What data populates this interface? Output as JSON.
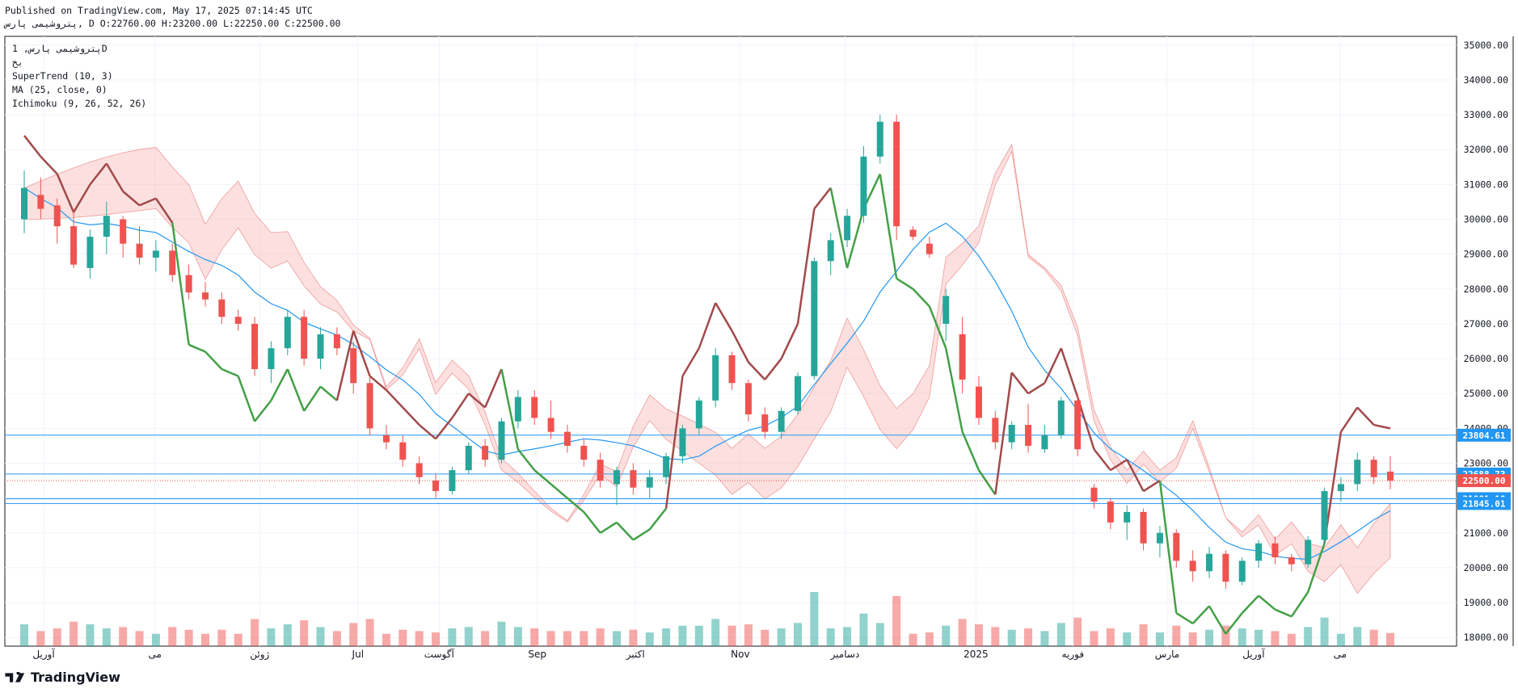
{
  "header": {
    "published": "Published on TradingView.com, May 17, 2025 07:14:45 UTC",
    "ohlc": "پتروشیمی پارس, D O:22760.00 H:23200.00 L:22250.00 C:22500.00"
  },
  "legend": {
    "symbol": "پتروشیمی پارس, 1D",
    "exchange": "بخ",
    "supertrend": "SuperTrend (10, 3)",
    "ma": "MA (25, close, 0)",
    "ichimoku": "Ichimoku (9, 26, 52, 26)"
  },
  "brand": "TradingView",
  "colors": {
    "up": "#26a69a",
    "down": "#ef5350",
    "st_up": "#43a047",
    "st_down": "#a24a4a",
    "ma": "#2196f3",
    "cloud_bull": "#a5d6a7",
    "cloud_bear": "#f8bbb8",
    "hline": "#2196f3",
    "last": "#ef5350"
  },
  "chart_data": {
    "type": "candlestick",
    "title": "پتروشیمی پارس, 1D",
    "x_labels": [
      "آوریل",
      "می",
      "ژوئن",
      "Jul",
      "آگوست",
      "Sep",
      "اکتبر",
      "Nov",
      "دسامبر",
      "2025",
      "فوریه",
      "مارس",
      "آوریل",
      "می"
    ],
    "y_ticks": [
      18000,
      19000,
      20000,
      21000,
      22000,
      23000,
      24000,
      25000,
      26000,
      27000,
      28000,
      29000,
      30000,
      31000,
      32000,
      33000,
      34000,
      35000
    ],
    "ylim": [
      17750,
      35250
    ],
    "horizontal_levels": [
      23804.61,
      22688.73,
      21981.1,
      21845.01
    ],
    "last_price": 22500.0,
    "candles_approx": [
      [
        30000,
        31400,
        29600,
        30900
      ],
      [
        30700,
        31200,
        30000,
        30300
      ],
      [
        30400,
        30600,
        29300,
        29800
      ],
      [
        29800,
        30300,
        28600,
        28700
      ],
      [
        28600,
        29700,
        28300,
        29500
      ],
      [
        29500,
        30500,
        29000,
        30100
      ],
      [
        30000,
        30100,
        28900,
        29300
      ],
      [
        29300,
        29800,
        28700,
        28900
      ],
      [
        28900,
        29400,
        28500,
        29100
      ],
      [
        29100,
        29300,
        28200,
        28400
      ],
      [
        28400,
        28700,
        27700,
        27900
      ],
      [
        27900,
        28200,
        27500,
        27700
      ],
      [
        27700,
        27900,
        27000,
        27200
      ],
      [
        27200,
        27400,
        26800,
        27000
      ],
      [
        27000,
        27200,
        25500,
        25700
      ],
      [
        25700,
        26500,
        25300,
        26300
      ],
      [
        26300,
        27400,
        26100,
        27200
      ],
      [
        27200,
        27400,
        25800,
        26000
      ],
      [
        26000,
        26900,
        25700,
        26700
      ],
      [
        26700,
        26900,
        26100,
        26300
      ],
      [
        26300,
        26500,
        25000,
        25300
      ],
      [
        25300,
        25500,
        23800,
        24000
      ],
      [
        23800,
        24100,
        23400,
        23600
      ],
      [
        23600,
        23800,
        22900,
        23100
      ],
      [
        23000,
        23200,
        22400,
        22600
      ],
      [
        22500,
        22700,
        22000,
        22200
      ],
      [
        22200,
        22900,
        22100,
        22800
      ],
      [
        22800,
        23600,
        22700,
        23500
      ],
      [
        23500,
        23700,
        22900,
        23100
      ],
      [
        23100,
        24300,
        23000,
        24200
      ],
      [
        24200,
        25100,
        24000,
        24900
      ],
      [
        24900,
        25100,
        24100,
        24300
      ],
      [
        24300,
        24800,
        23700,
        23900
      ],
      [
        23900,
        24100,
        23300,
        23500
      ],
      [
        23500,
        23700,
        22900,
        23100
      ],
      [
        23100,
        23300,
        22300,
        22500
      ],
      [
        22400,
        22900,
        21800,
        22800
      ],
      [
        22800,
        23000,
        22100,
        22300
      ],
      [
        22300,
        22800,
        22000,
        22600
      ],
      [
        22600,
        23300,
        22400,
        23200
      ],
      [
        23200,
        24100,
        23000,
        24000
      ],
      [
        24000,
        24900,
        23800,
        24800
      ],
      [
        24800,
        26300,
        24600,
        26100
      ],
      [
        26100,
        26200,
        25100,
        25300
      ],
      [
        25300,
        25400,
        24200,
        24400
      ],
      [
        24400,
        24600,
        23700,
        23900
      ],
      [
        23900,
        24600,
        23700,
        24500
      ],
      [
        24500,
        25600,
        24400,
        25500
      ],
      [
        25500,
        28900,
        25400,
        28800
      ],
      [
        28800,
        29600,
        28400,
        29400
      ],
      [
        29400,
        30300,
        29200,
        30100
      ],
      [
        30100,
        32100,
        29900,
        31800
      ],
      [
        31800,
        33000,
        31600,
        32800
      ],
      [
        32800,
        33000,
        29400,
        29800
      ],
      [
        29700,
        29800,
        29400,
        29500
      ],
      [
        29300,
        29500,
        28900,
        29000
      ],
      [
        27000,
        28000,
        26500,
        27800
      ],
      [
        26700,
        27200,
        25000,
        25400
      ],
      [
        25200,
        25500,
        24100,
        24300
      ],
      [
        24300,
        24500,
        23400,
        23600
      ],
      [
        23600,
        24200,
        23400,
        24100
      ],
      [
        24100,
        24700,
        23300,
        23500
      ],
      [
        23400,
        24100,
        23300,
        23800
      ],
      [
        23800,
        24900,
        23700,
        24800
      ],
      [
        24800,
        25000,
        23200,
        23400
      ],
      [
        22300,
        22400,
        21700,
        21900
      ],
      [
        21900,
        22000,
        21100,
        21300
      ],
      [
        21300,
        21800,
        20800,
        21600
      ],
      [
        21600,
        21700,
        20500,
        20700
      ],
      [
        20700,
        21200,
        20300,
        21000
      ],
      [
        21000,
        21100,
        20000,
        20200
      ],
      [
        20200,
        20500,
        19600,
        19900
      ],
      [
        19900,
        20600,
        19700,
        20400
      ],
      [
        20400,
        20500,
        19400,
        19600
      ],
      [
        19600,
        20300,
        19500,
        20200
      ],
      [
        20200,
        20800,
        20000,
        20700
      ],
      [
        20700,
        20900,
        20100,
        20300
      ],
      [
        20300,
        20400,
        19900,
        20100
      ],
      [
        20100,
        20900,
        20000,
        20800
      ],
      [
        20800,
        22300,
        20700,
        22200
      ],
      [
        22200,
        22600,
        21900,
        22400
      ],
      [
        22400,
        23300,
        22200,
        23100
      ],
      [
        23100,
        23200,
        22400,
        22600
      ],
      [
        22760,
        23200,
        22250,
        22500
      ]
    ],
    "supertrend_note": "alternating up (green) and down (brown) trailing stop",
    "ma_period": 25
  }
}
